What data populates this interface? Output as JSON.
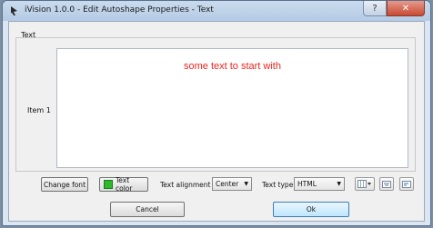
{
  "window": {
    "title": "iVision 1.0.0 - Edit Autoshape Properties - Text",
    "help_glyph": "?",
    "close_glyph": "✕"
  },
  "group": {
    "label": "Text"
  },
  "item": {
    "label": "Item 1",
    "text_value": "some text to start with",
    "text_color": "#e8251f"
  },
  "toolbar": {
    "change_font_label": "Change font",
    "text_color_label": "Text color",
    "text_color_swatch": "#2eb82e",
    "text_alignment_label": "Text alignment",
    "text_alignment_value": "Center",
    "text_type_label": "Text type",
    "text_type_value": "HTML",
    "align_icons": [
      "grid-align-icon",
      "align-center-icon",
      "align-left-icon"
    ]
  },
  "actions": {
    "cancel_label": "Cancel",
    "ok_label": "Ok"
  }
}
